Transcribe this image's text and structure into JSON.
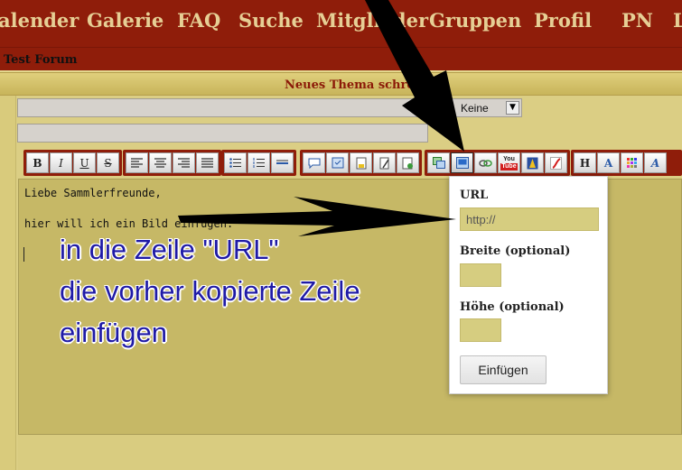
{
  "nav": {
    "items": [
      "alender",
      "Galerie",
      "FAQ",
      "Suche",
      "Mitglieder",
      "Gruppen",
      "Profil",
      "PN",
      "L"
    ]
  },
  "breadcrumb": {
    "forum": "Test Forum"
  },
  "thread": {
    "title": "Neues Thema schreiben"
  },
  "form": {
    "prefix_select_value": "Keine"
  },
  "toolbar": {
    "groups": [
      [
        "bold-icon",
        "italic-icon",
        "underline-icon",
        "strikethrough-icon"
      ],
      [
        "align-left-icon",
        "align-center-icon",
        "align-right-icon",
        "align-justify-icon"
      ],
      [
        "bullet-list-icon",
        "numbered-list-icon",
        "horizontal-rule-icon"
      ],
      [
        "quote-icon",
        "code-icon",
        "php-icon",
        "edit-icon",
        "insert-icon"
      ],
      [
        "image-gallery-icon",
        "image-icon",
        "link-icon",
        "youtube-icon",
        "user-icon",
        "flash-icon"
      ],
      [
        "heading-icon",
        "font-size-icon",
        "color-icon",
        "font-family-icon"
      ]
    ],
    "labels": {
      "bold": "B",
      "italic": "I",
      "underline": "U",
      "strike": "S",
      "heading": "H",
      "youtube": "You Tube"
    }
  },
  "editor": {
    "line1": "Liebe Sammlerfreunde,",
    "line2": "hier will ich ein Bild einfügen:"
  },
  "annotation": {
    "line1": "in die Zeile \"URL\"",
    "line2": "die vorher kopierte Zeile",
    "line3": "einfügen"
  },
  "image_popup": {
    "url_label": "URL",
    "url_placeholder": "http://",
    "width_label": "Breite (optional)",
    "height_label": "Höhe (optional)",
    "insert_button": "Einfügen"
  },
  "colors": {
    "nav_bg": "#8f1d0a",
    "nav_text": "#e6cf95",
    "page_bg": "#e3d68e",
    "editor_bg": "#c6b866",
    "annotation_text": "#1f1aa6"
  }
}
